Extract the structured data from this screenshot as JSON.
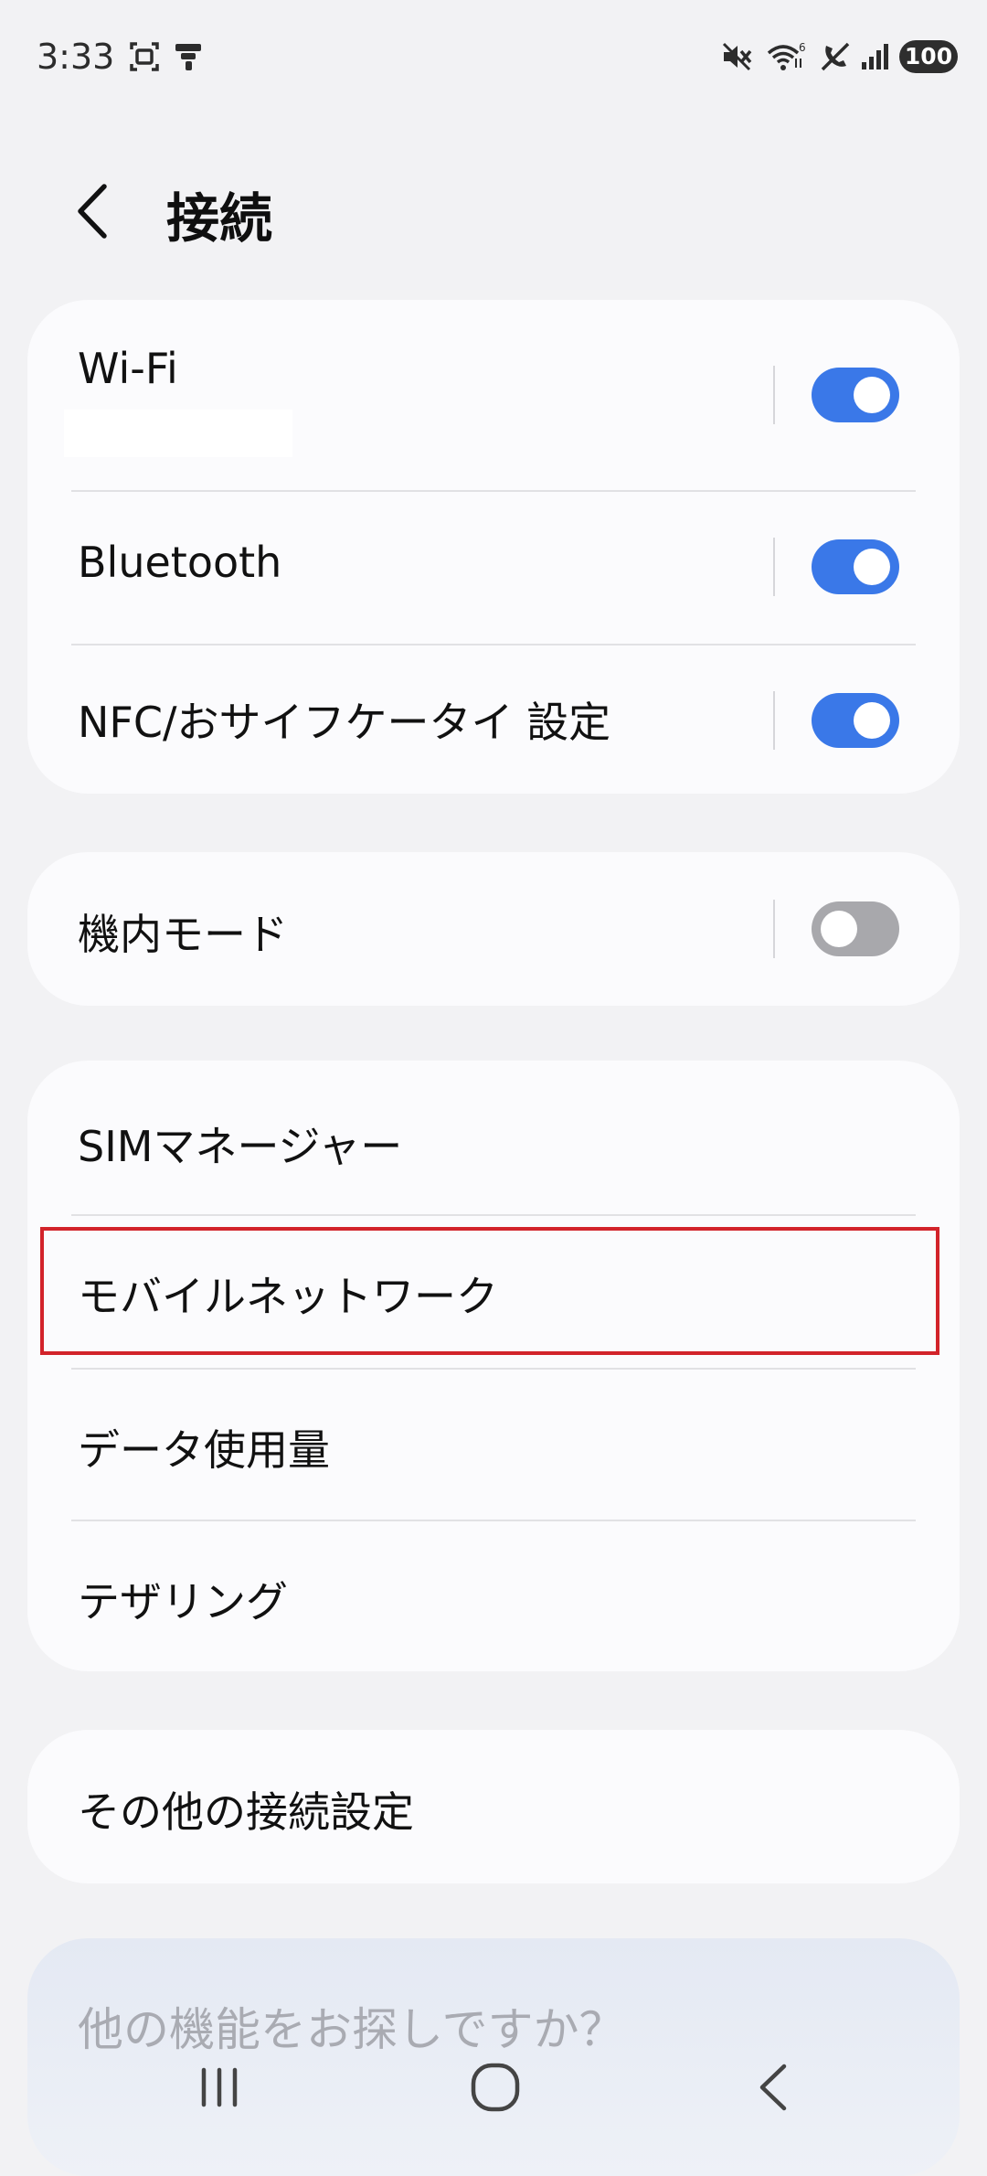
{
  "status_bar": {
    "time": "3:33",
    "battery": "100",
    "left_icons": [
      "screen-recorder-icon",
      "notification-icon"
    ],
    "right_icons": [
      "mute-icon",
      "wifi-6-icon",
      "no-call-icon",
      "signal-icon"
    ]
  },
  "header": {
    "back_icon": "chevron-left-icon",
    "title": "接続"
  },
  "connection_card": {
    "items": [
      {
        "label": "Wi-Fi",
        "toggle": "on"
      },
      {
        "label": "Bluetooth",
        "toggle": "on"
      },
      {
        "label": "NFC/おサイフケータイ 設定",
        "toggle": "on"
      }
    ]
  },
  "airplane_card": {
    "label": "機内モード",
    "toggle": "off"
  },
  "network_card": {
    "items": [
      {
        "label": "SIMマネージャー"
      },
      {
        "label": "モバイルネットワーク",
        "highlighted": true
      },
      {
        "label": "データ使用量"
      },
      {
        "label": "テザリング"
      }
    ]
  },
  "more_card": {
    "label": "その他の接続設定"
  },
  "suggestion": {
    "text": "他の機能をお探しですか？"
  },
  "nav_bar": {
    "icons": [
      "recent-apps-icon",
      "home-icon",
      "back-icon"
    ]
  },
  "colors": {
    "accent": "#3a78e8",
    "highlight": "#d2232a",
    "background": "#f2f2f4",
    "card": "#fbfbfd"
  }
}
